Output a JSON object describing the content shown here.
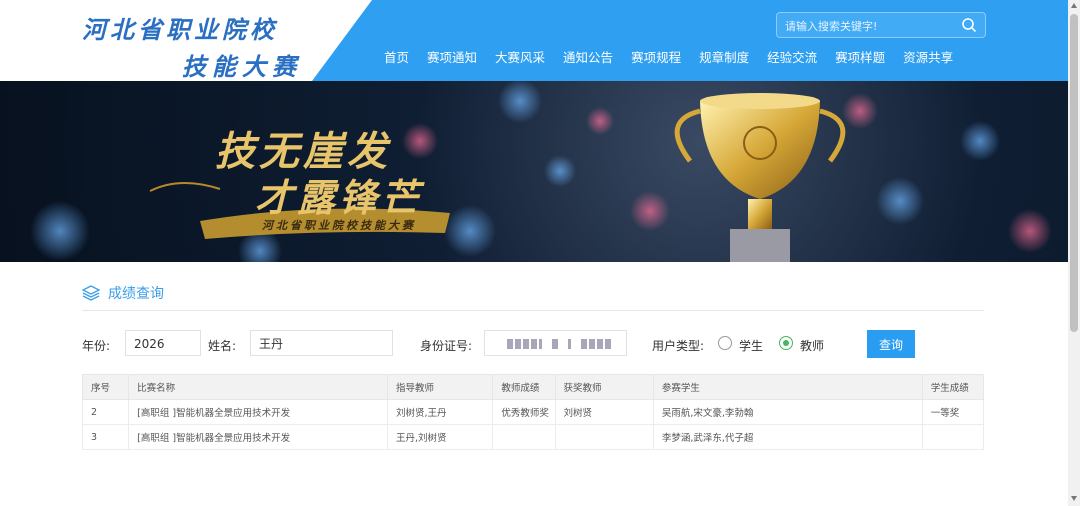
{
  "header": {
    "logo_line1": "河北省职业院校",
    "logo_line2": "技能大赛",
    "search_placeholder": "请输入搜索关键字!",
    "nav": [
      "首页",
      "赛项通知",
      "大赛风采",
      "通知公告",
      "赛项规程",
      "规章制度",
      "经验交流",
      "赛项样题",
      "资源共享"
    ]
  },
  "banner": {
    "slogan_line1": "技无崖发",
    "slogan_line2": "才露锋芒",
    "slogan_sub": "河北省职业院校技能大赛"
  },
  "section": {
    "title": "成绩查询",
    "icon": "layers-icon"
  },
  "form": {
    "year_label": "年份:",
    "year_value": "2026",
    "name_label": "姓名:",
    "name_value": "王丹",
    "id_label": "身份证号:",
    "usertype_label": "用户类型:",
    "radio_student": "学生",
    "radio_teacher": "教师",
    "selected": "教师",
    "query_button": "查询"
  },
  "table": {
    "headers": [
      "序号",
      "比赛名称",
      "指导教师",
      "教师成绩",
      "获奖教师",
      "参赛学生",
      "学生成绩"
    ],
    "rows": [
      [
        "2",
        "[高职组 ]智能机器全景应用技术开发",
        "刘树贤,王丹",
        "优秀教师奖",
        "刘树贤",
        "吴雨航,宋文豪,李勃翰",
        "一等奖"
      ],
      [
        "3",
        "[高职组 ]智能机器全景应用技术开发",
        "王丹,刘树贤",
        "",
        "",
        "李梦涵,武泽东,代子超",
        ""
      ]
    ]
  },
  "colors": {
    "accent": "#2a9cf2",
    "header_blue": "#3ba7f5",
    "logo_blue": "#2a6fc2",
    "radio_green": "#46b55f"
  }
}
